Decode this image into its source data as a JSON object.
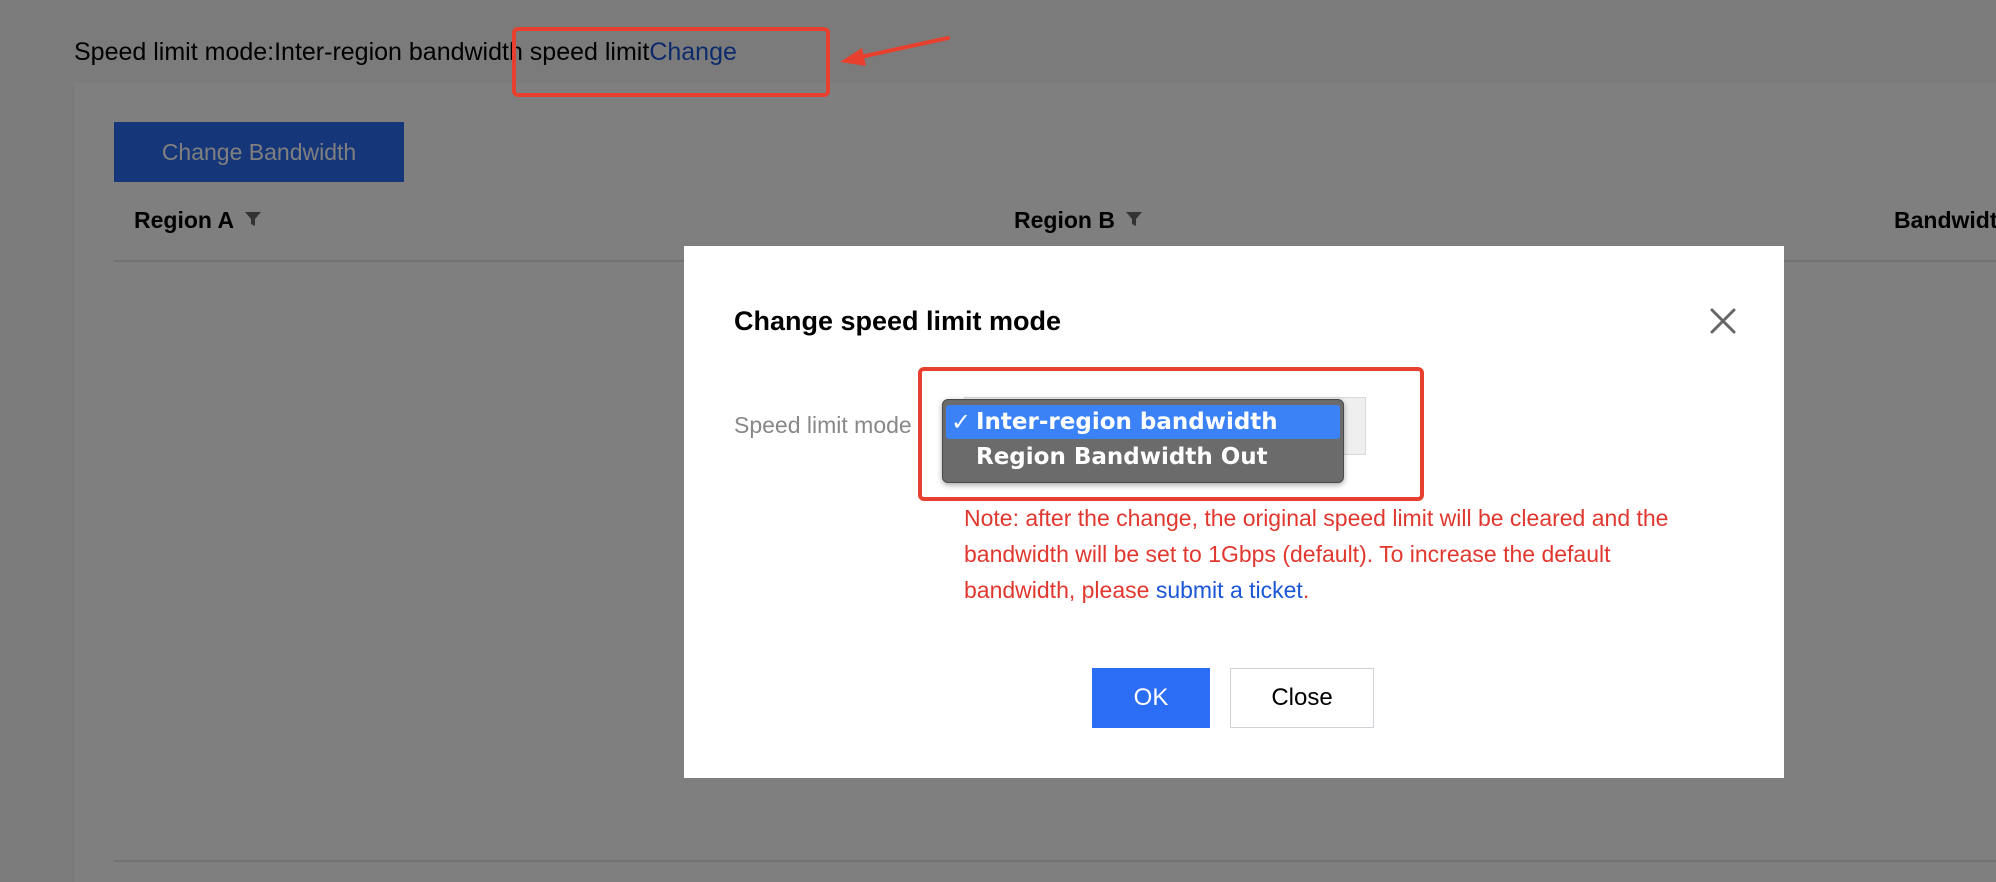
{
  "page": {
    "mode_prefix": "Speed limit mode:Inter-region bandwidth speed limit",
    "change_link": "Change",
    "change_bandwidth_button": "Change Bandwidth",
    "columns": [
      "Region A",
      "Region B",
      "Bandwidt"
    ]
  },
  "modal": {
    "title": "Change speed limit mode",
    "field_label": "Speed limit mode",
    "dropdown": {
      "selected": "Inter-region bandwidth",
      "options": [
        {
          "label": "Inter-region bandwidth",
          "checked": "✓"
        },
        {
          "label": "Region Bandwidth Out",
          "checked": ""
        }
      ]
    },
    "note_text": "Note: after the change, the original speed limit will be cleared and the bandwidth will be set to 1Gbps (default). To increase the default bandwidth, please ",
    "note_link": "submit a ticket",
    "note_end": ".",
    "ok_button": "OK",
    "close_button": "Close"
  },
  "colors": {
    "accent": "#2b6ef5",
    "link": "#1a56d6",
    "warning_text": "#e0382f",
    "annotation": "#e8402f"
  }
}
